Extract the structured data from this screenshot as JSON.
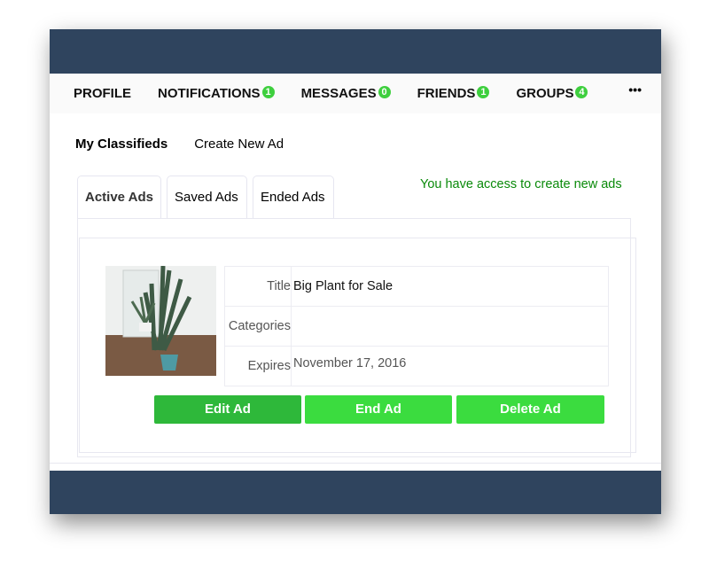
{
  "nav": {
    "items": [
      {
        "label": "PROFILE"
      },
      {
        "label": "NOTIFICATIONS",
        "badge": "1"
      },
      {
        "label": "MESSAGES",
        "badge": "0"
      },
      {
        "label": "FRIENDS",
        "badge": "1"
      },
      {
        "label": "GROUPS",
        "badge": "4"
      }
    ],
    "more": "•••"
  },
  "subnav": {
    "my_classifieds": "My Classifieds",
    "create": "Create New Ad"
  },
  "tabs": [
    {
      "label": "Active Ads"
    },
    {
      "label": "Saved Ads"
    },
    {
      "label": "Ended Ads"
    }
  ],
  "access_message": "You have access to create new ads",
  "ad": {
    "title_label": "Title",
    "title": "Big Plant for Sale",
    "categories_label": "Categories",
    "categories": "",
    "expires_label": "Expires",
    "expires": "November 17, 2016"
  },
  "buttons": {
    "edit": "Edit Ad",
    "end": "End Ad",
    "delete": "Delete Ad"
  },
  "colors": {
    "header": "#2f445e",
    "badge": "#3ecf3e",
    "access": "#0a8a0a",
    "edit": "#2eb83a",
    "button": "#3bdc3f"
  }
}
